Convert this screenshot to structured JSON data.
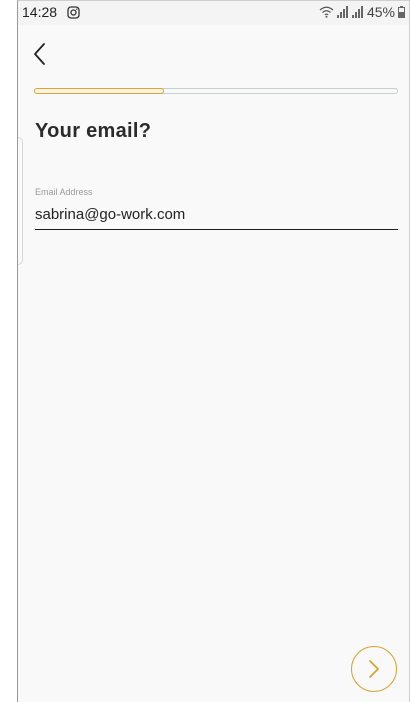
{
  "status_bar": {
    "time": "14:28",
    "battery": "45%"
  },
  "nav": {
    "back_icon": "chevron-left-icon"
  },
  "progress": {
    "value": 0.36
  },
  "form": {
    "title": "Your email?",
    "email_label": "Email Address",
    "email_value": "sabrina@go-work.com"
  },
  "actions": {
    "next_icon": "chevron-right-icon"
  },
  "colors": {
    "accent": "#d7a336",
    "background": "#f9f9f9",
    "text": "#2b2b2b"
  }
}
